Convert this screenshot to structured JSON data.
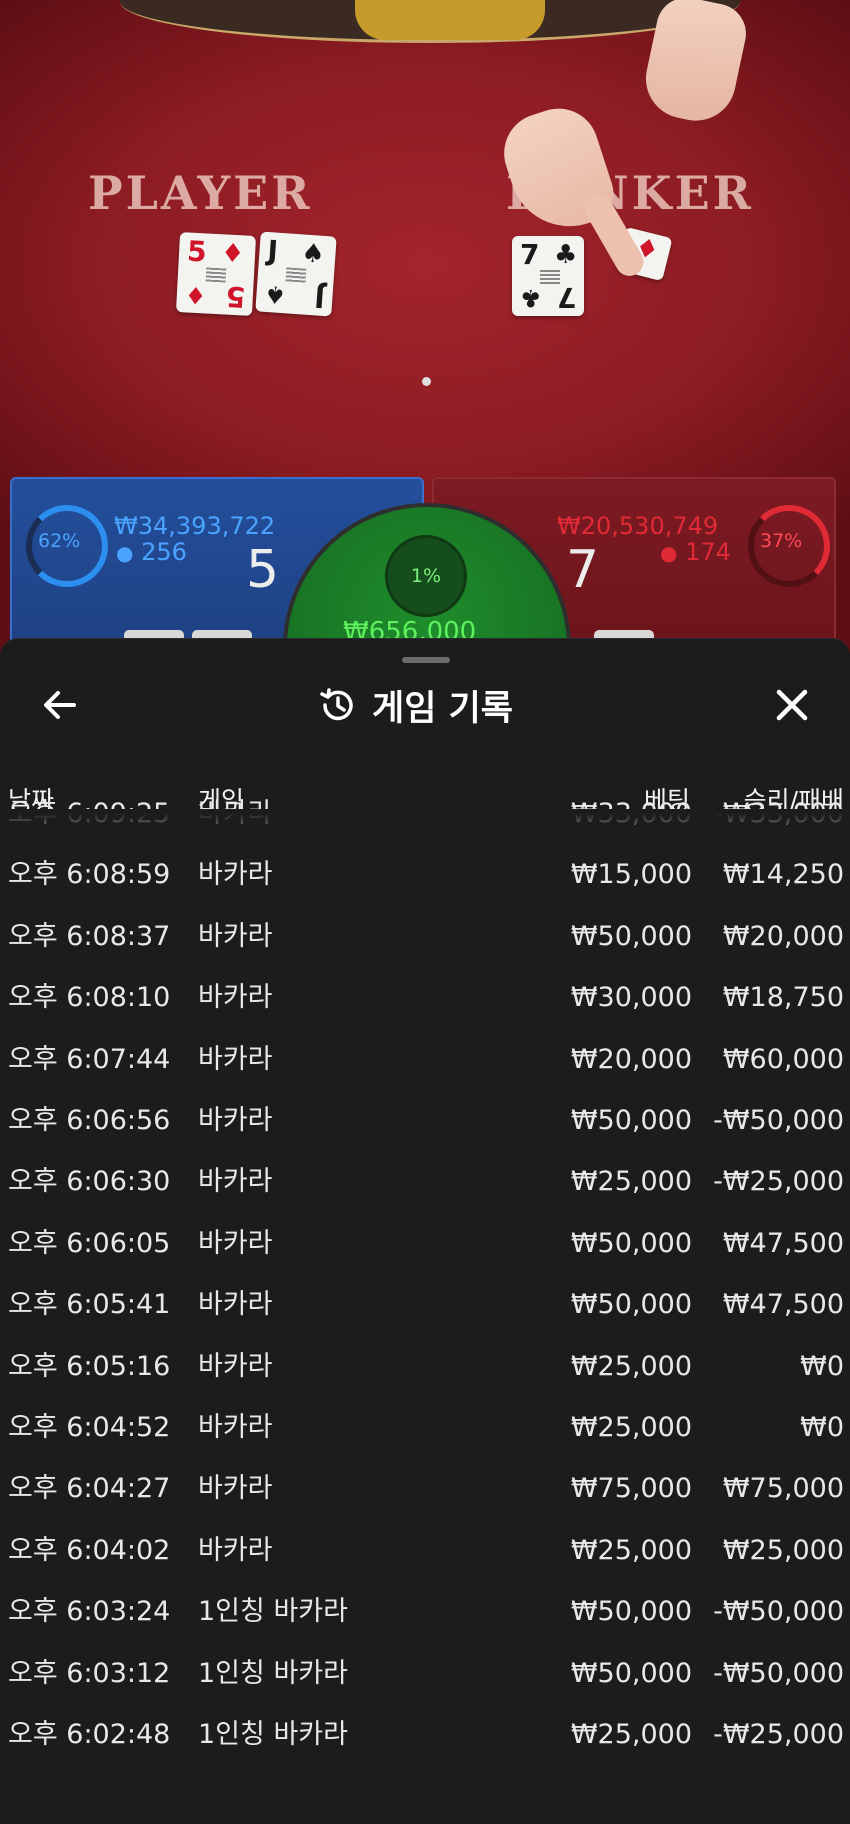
{
  "table": {
    "player_label": "PLAYER",
    "banker_label": "BANKER",
    "player_cards": [
      {
        "rank": "5",
        "suit": "♦",
        "color": "red"
      },
      {
        "rank": "J",
        "suit": "♠",
        "color": "black"
      }
    ],
    "banker_cards": [
      {
        "rank": "7",
        "suit": "♣",
        "color": "black"
      },
      {
        "rank": "",
        "suit": "♦",
        "color": "red"
      }
    ],
    "player_bet": {
      "percent": "62%",
      "amount": "₩34,393,722",
      "count": "256",
      "score": "5"
    },
    "banker_bet": {
      "percent": "37%",
      "amount": "₩20,530,749",
      "count": "174",
      "score": "7"
    },
    "tie_bet": {
      "percent": "1%",
      "amount": "₩656,000"
    },
    "colors": {
      "player": "#2c8ff0",
      "banker": "#e02a36",
      "tie": "#5ff05f"
    }
  },
  "sheet": {
    "title": "게임 기록",
    "icons": {
      "back": "arrow-left-icon",
      "history": "history-icon",
      "close": "close-icon"
    },
    "columns": {
      "date": "날짜",
      "game": "게임",
      "bet": "베팅",
      "result": "승리/패배"
    },
    "rows": [
      {
        "date": "오후 6:09:25",
        "game": "바카라",
        "bet": "₩33,000",
        "result": "-₩33,000"
      },
      {
        "date": "오후 6:08:59",
        "game": "바카라",
        "bet": "₩15,000",
        "result": "₩14,250"
      },
      {
        "date": "오후 6:08:37",
        "game": "바카라",
        "bet": "₩50,000",
        "result": "₩20,000"
      },
      {
        "date": "오후 6:08:10",
        "game": "바카라",
        "bet": "₩30,000",
        "result": "₩18,750"
      },
      {
        "date": "오후 6:07:44",
        "game": "바카라",
        "bet": "₩20,000",
        "result": "₩60,000"
      },
      {
        "date": "오후 6:06:56",
        "game": "바카라",
        "bet": "₩50,000",
        "result": "-₩50,000"
      },
      {
        "date": "오후 6:06:30",
        "game": "바카라",
        "bet": "₩25,000",
        "result": "-₩25,000"
      },
      {
        "date": "오후 6:06:05",
        "game": "바카라",
        "bet": "₩50,000",
        "result": "₩47,500"
      },
      {
        "date": "오후 6:05:41",
        "game": "바카라",
        "bet": "₩50,000",
        "result": "₩47,500"
      },
      {
        "date": "오후 6:05:16",
        "game": "바카라",
        "bet": "₩25,000",
        "result": "₩0"
      },
      {
        "date": "오후 6:04:52",
        "game": "바카라",
        "bet": "₩25,000",
        "result": "₩0"
      },
      {
        "date": "오후 6:04:27",
        "game": "바카라",
        "bet": "₩75,000",
        "result": "₩75,000"
      },
      {
        "date": "오후 6:04:02",
        "game": "바카라",
        "bet": "₩25,000",
        "result": "₩25,000"
      },
      {
        "date": "오후 6:03:24",
        "game": "1인칭 바카라",
        "bet": "₩50,000",
        "result": "-₩50,000"
      },
      {
        "date": "오후 6:03:12",
        "game": "1인칭 바카라",
        "bet": "₩50,000",
        "result": "-₩50,000"
      },
      {
        "date": "오후 6:02:48",
        "game": "1인칭 바카라",
        "bet": "₩25,000",
        "result": "-₩25,000"
      }
    ]
  }
}
